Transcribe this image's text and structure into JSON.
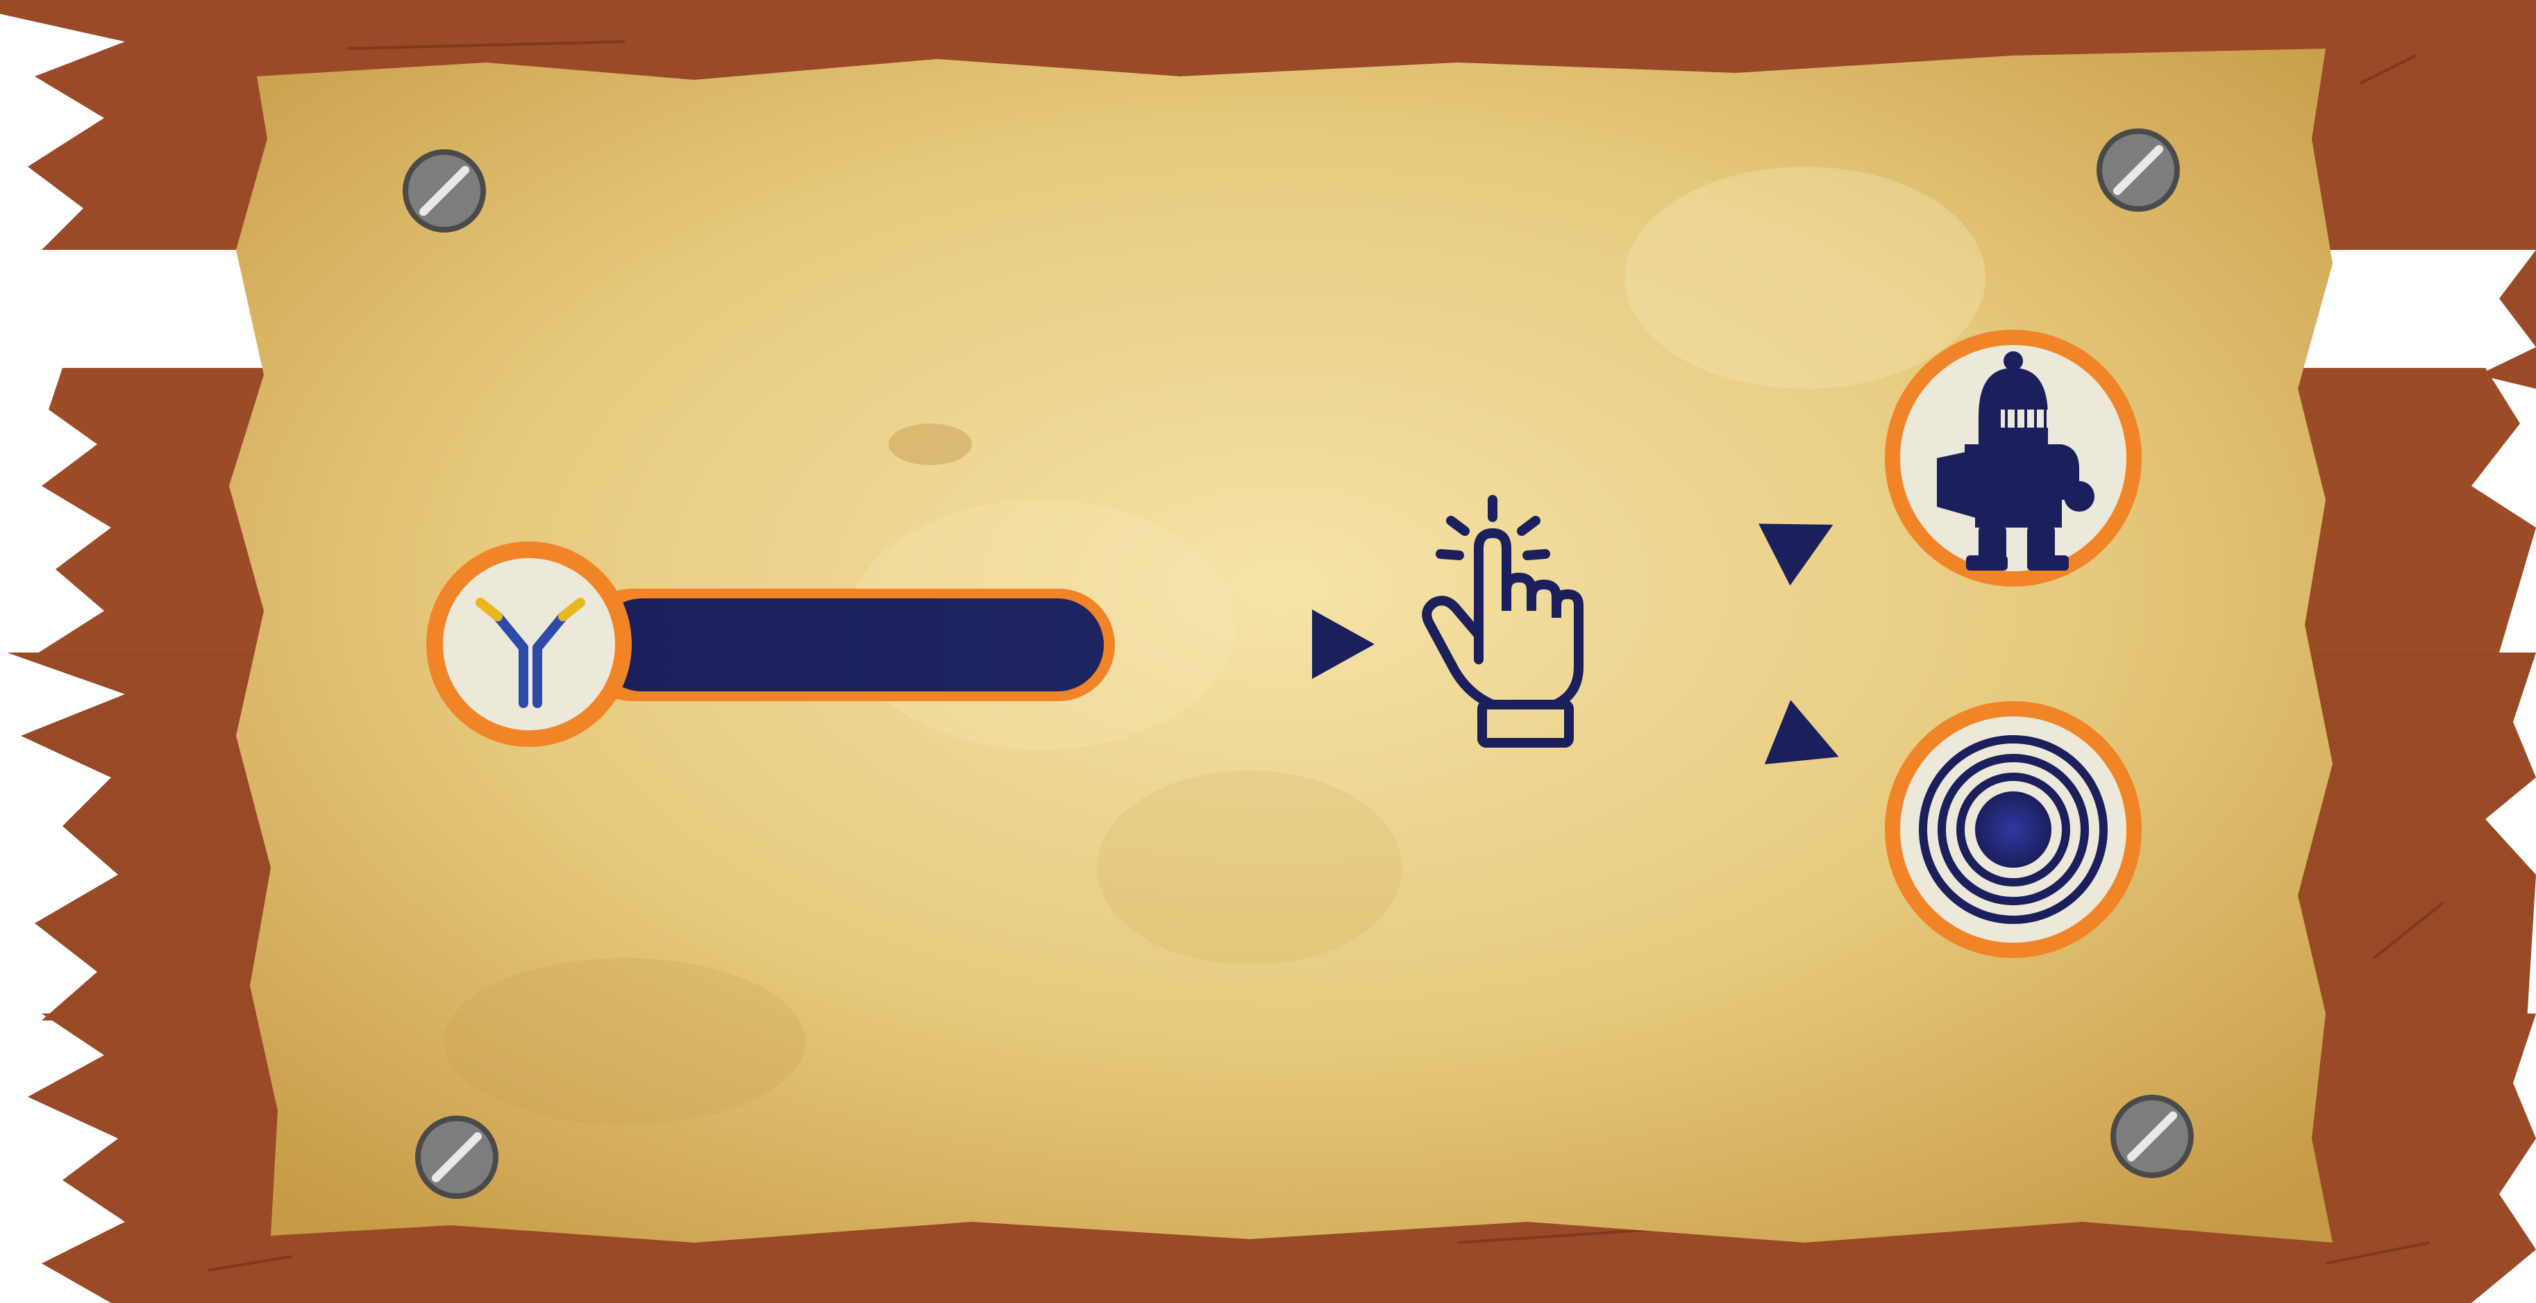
{
  "scene": {
    "type": "wooden-notice-board-parchment",
    "colors": {
      "wood": "#9a4a26",
      "wood_dark": "#6e2c12",
      "parchment_light": "#f3dfa0",
      "parchment_dark": "#c49a48",
      "navy": "#1b1f5c",
      "orange_ring": "#f08426",
      "badge_fill": "#ece8da",
      "screw": "#7d7d7d"
    }
  },
  "screws": [
    {
      "name": "screw-top-left",
      "icon": "screw-icon"
    },
    {
      "name": "screw-top-right",
      "icon": "screw-icon"
    },
    {
      "name": "screw-bottom-left",
      "icon": "screw-icon"
    },
    {
      "name": "screw-bottom-right",
      "icon": "screw-icon"
    }
  ],
  "antibody_badge": {
    "icon": "antibody-icon"
  },
  "progress_bar": {
    "fill_percent": 100
  },
  "tap_icon": {
    "icon": "tap-finger-icon"
  },
  "arrows": [
    "arrow-right-icon",
    "arrow-up-right-icon",
    "arrow-down-right-icon"
  ],
  "outcomes": [
    {
      "name": "outcome-knight-badge",
      "icon": "knight-icon"
    },
    {
      "name": "outcome-target-badge",
      "icon": "target-icon"
    }
  ]
}
